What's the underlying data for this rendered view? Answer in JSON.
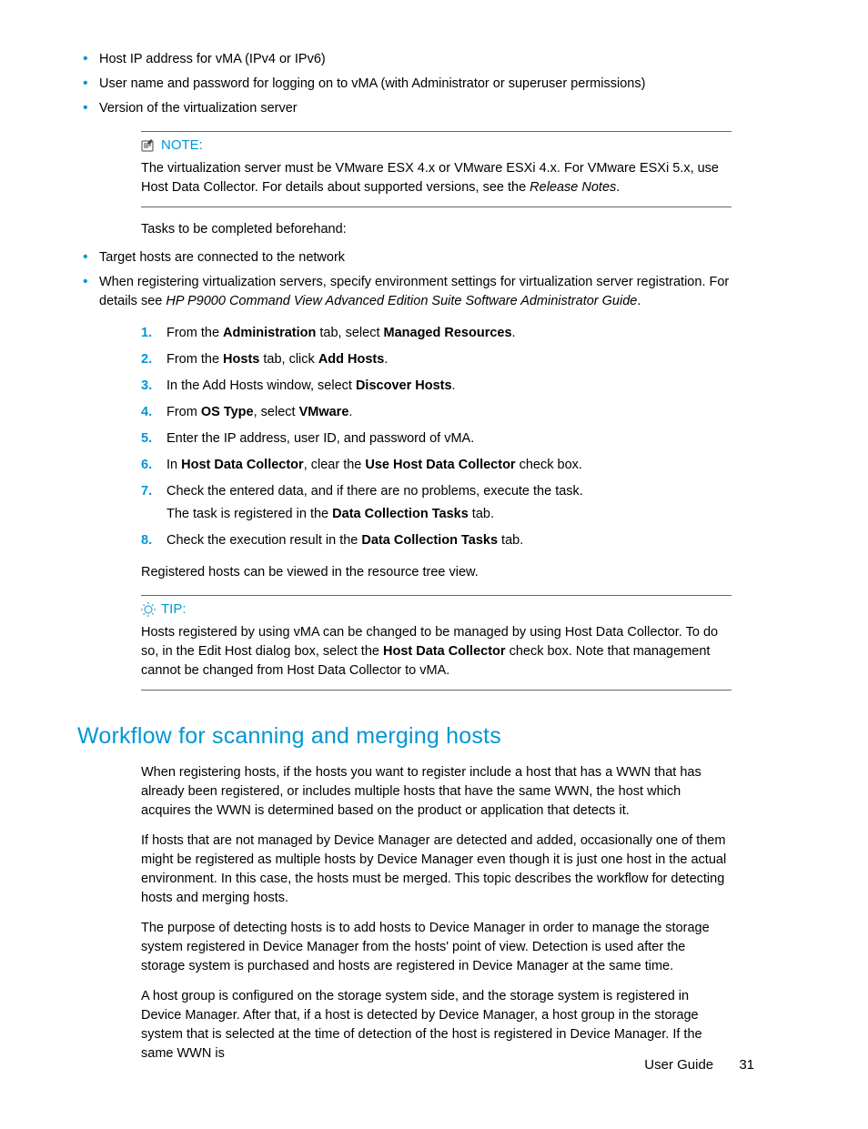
{
  "bullets_top": [
    "Host IP address for vMA (IPv4 or IPv6)",
    "User name and password for logging on to vMA (with Administrator or superuser permissions)",
    "Version of the virtualization server"
  ],
  "note": {
    "label": "NOTE:",
    "body_prefix": "The virtualization server must be VMware ESX 4.x or VMware ESXi 4.x. For VMware ESXi 5.x, use Host Data Collector. For details about supported versions, see the ",
    "body_italic": "Release Notes",
    "body_suffix": "."
  },
  "tasks_heading": "Tasks to be completed beforehand:",
  "bullets_tasks": [
    {
      "text": "Target hosts are connected to the network"
    },
    {
      "text": "When registering virtualization servers, specify environment settings for virtualization server registration. For details see ",
      "italic": "HP P9000 Command View Advanced Edition Suite Software Administrator Guide",
      "suffix": "."
    }
  ],
  "steps": [
    {
      "pre": "From the ",
      "b1": "Administration",
      "mid": " tab, select ",
      "b2": "Managed Resources",
      "post": "."
    },
    {
      "pre": "From the ",
      "b1": "Hosts",
      "mid": " tab, click ",
      "b2": "Add Hosts",
      "post": "."
    },
    {
      "pre": "In the Add Hosts window, select ",
      "b1": "Discover Hosts",
      "post": "."
    },
    {
      "pre": "From ",
      "b1": "OS Type",
      "mid": ", select ",
      "b2": "VMware",
      "post": "."
    },
    {
      "plain": "Enter the IP address, user ID, and password of vMA."
    },
    {
      "pre": "In ",
      "b1": "Host Data Collector",
      "mid": ", clear the ",
      "b2": "Use Host Data Collector",
      "post": " check box."
    },
    {
      "plain": "Check the entered data, and if there are no problems, execute the task.",
      "sub_pre": "The task is registered in the ",
      "sub_b": "Data Collection Tasks",
      "sub_post": " tab."
    },
    {
      "pre": "Check the execution result in the ",
      "b1": "Data Collection Tasks",
      "post": " tab."
    }
  ],
  "after_steps": "Registered hosts can be viewed in the resource tree view.",
  "tip": {
    "label": "TIP:",
    "pre": "Hosts registered by using vMA can be changed to be managed by using Host Data Collector. To do so, in the Edit Host dialog box, select the ",
    "bold": "Host Data Collector",
    "post": " check box. Note that management cannot be changed from Host Data Collector to vMA."
  },
  "section_title": "Workflow for scanning and merging hosts",
  "paras": [
    "When registering hosts, if the hosts you want to register include a host that has a WWN that has already been registered, or includes multiple hosts that have the same WWN, the host which acquires the WWN is determined based on the product or application that detects it.",
    "If hosts that are not managed by Device Manager are detected and added, occasionally one of them might be registered as multiple hosts by Device Manager even though it is just one host in the actual environment. In this case, the hosts must be merged. This topic describes the workflow for detecting hosts and merging hosts.",
    "The purpose of detecting hosts is to add hosts to Device Manager in order to manage the storage system registered in Device Manager from the hosts' point of view. Detection is used after the storage system is purchased and hosts are registered in Device Manager at the same time.",
    "A host group is configured on the storage system side, and the storage system is registered in Device Manager. After that, if a host is detected by Device Manager, a host group in the storage system that is selected at the time of detection of the host is registered in Device Manager. If the same WWN is"
  ],
  "footer": {
    "label": "User Guide",
    "page": "31"
  }
}
